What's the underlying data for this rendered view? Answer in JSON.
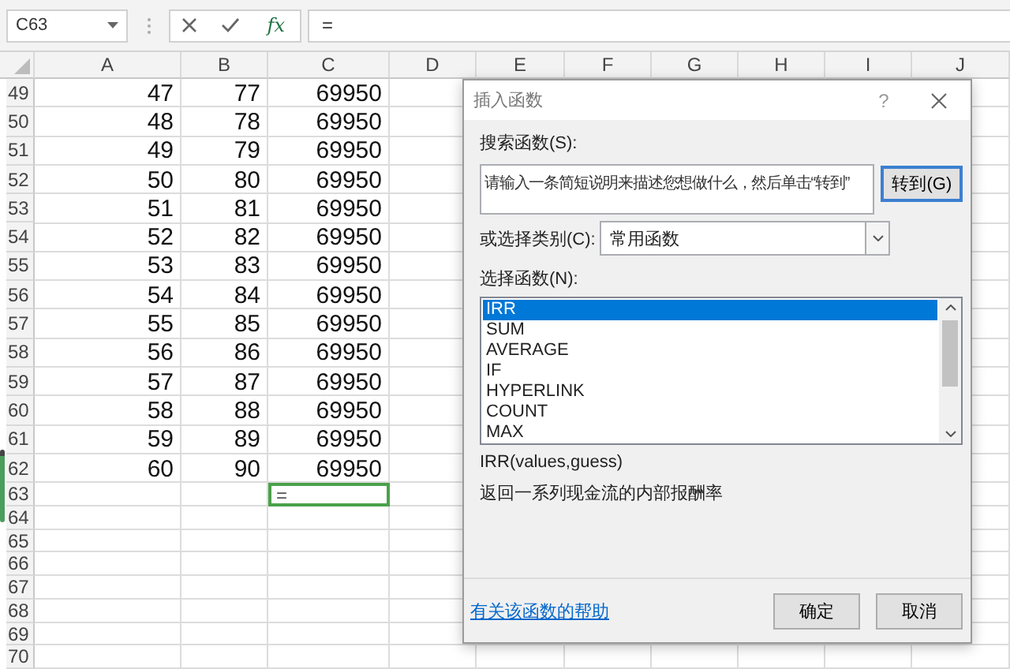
{
  "formula_bar": {
    "name_box": "C63",
    "function_button": "fx",
    "formula": "="
  },
  "columns": [
    "A",
    "B",
    "C",
    "D",
    "E",
    "F",
    "G",
    "H",
    "I",
    "J"
  ],
  "rows": [
    {
      "number": "49",
      "cells": [
        {
          "text": "47",
          "selected": false
        },
        {
          "text": "77",
          "selected": false
        },
        {
          "text": "69950",
          "selected": false
        }
      ]
    },
    {
      "number": "50",
      "cells": [
        {
          "text": "48",
          "selected": false
        },
        {
          "text": "78",
          "selected": false
        },
        {
          "text": "69950",
          "selected": false
        }
      ]
    },
    {
      "number": "51",
      "cells": [
        {
          "text": "49",
          "selected": false
        },
        {
          "text": "79",
          "selected": false
        },
        {
          "text": "69950",
          "selected": false
        }
      ]
    },
    {
      "number": "52",
      "cells": [
        {
          "text": "50",
          "selected": false
        },
        {
          "text": "80",
          "selected": false
        },
        {
          "text": "69950",
          "selected": false
        }
      ]
    },
    {
      "number": "53",
      "cells": [
        {
          "text": "51",
          "selected": false
        },
        {
          "text": "81",
          "selected": false
        },
        {
          "text": "69950",
          "selected": false
        }
      ]
    },
    {
      "number": "54",
      "cells": [
        {
          "text": "52",
          "selected": false
        },
        {
          "text": "82",
          "selected": false
        },
        {
          "text": "69950",
          "selected": false
        }
      ]
    },
    {
      "number": "55",
      "cells": [
        {
          "text": "53",
          "selected": false
        },
        {
          "text": "83",
          "selected": false
        },
        {
          "text": "69950",
          "selected": false
        }
      ]
    },
    {
      "number": "56",
      "cells": [
        {
          "text": "54",
          "selected": false
        },
        {
          "text": "84",
          "selected": false
        },
        {
          "text": "69950",
          "selected": false
        }
      ]
    },
    {
      "number": "57",
      "cells": [
        {
          "text": "55",
          "selected": false
        },
        {
          "text": "85",
          "selected": false
        },
        {
          "text": "69950",
          "selected": false
        }
      ]
    },
    {
      "number": "58",
      "cells": [
        {
          "text": "56",
          "selected": false
        },
        {
          "text": "86",
          "selected": false
        },
        {
          "text": "69950",
          "selected": false
        }
      ]
    },
    {
      "number": "59",
      "cells": [
        {
          "text": "57",
          "selected": false
        },
        {
          "text": "87",
          "selected": false
        },
        {
          "text": "69950",
          "selected": false
        }
      ]
    },
    {
      "number": "60",
      "cells": [
        {
          "text": "58",
          "selected": false
        },
        {
          "text": "88",
          "selected": false
        },
        {
          "text": "69950",
          "selected": false
        }
      ]
    },
    {
      "number": "61",
      "cells": [
        {
          "text": "59",
          "selected": false
        },
        {
          "text": "89",
          "selected": false
        },
        {
          "text": "69950",
          "selected": false
        }
      ]
    },
    {
      "number": "62",
      "cells": [
        {
          "text": "60",
          "selected": false
        },
        {
          "text": "90",
          "selected": false
        },
        {
          "text": "69950",
          "selected": false
        }
      ]
    },
    {
      "number": "63",
      "cells": [
        {
          "selected": false
        },
        {
          "selected": false
        },
        {
          "text": "=",
          "selected": true
        }
      ]
    },
    {
      "number": "64"
    },
    {
      "number": "65"
    },
    {
      "number": "66"
    },
    {
      "number": "67"
    },
    {
      "number": "68"
    },
    {
      "number": "69"
    },
    {
      "number": "70"
    }
  ],
  "dialog": {
    "title": "插入函数",
    "help_button": "?",
    "search_label": "搜索函数(S):",
    "search_field": {
      "value": "请输入一条简短说明来描述您想做什么，然后单击“转到”"
    },
    "go_button": "转到(G)",
    "category": {
      "label": "或选择类别(C):",
      "value": "常用函数"
    },
    "list_label": "选择函数(N):",
    "functions": [
      {
        "name": "IRR",
        "selected": true
      },
      {
        "name": "SUM",
        "selected": false
      },
      {
        "name": "AVERAGE",
        "selected": false
      },
      {
        "name": "IF",
        "selected": false
      },
      {
        "name": "HYPERLINK",
        "selected": false
      },
      {
        "name": "COUNT",
        "selected": false
      },
      {
        "name": "MAX",
        "selected": false
      }
    ],
    "signature": "IRR(values,guess)",
    "description": "返回一系列现金流的内部报酬率",
    "help_link": "有关该函数的帮助",
    "buttons": [
      "确定",
      "取消"
    ]
  }
}
